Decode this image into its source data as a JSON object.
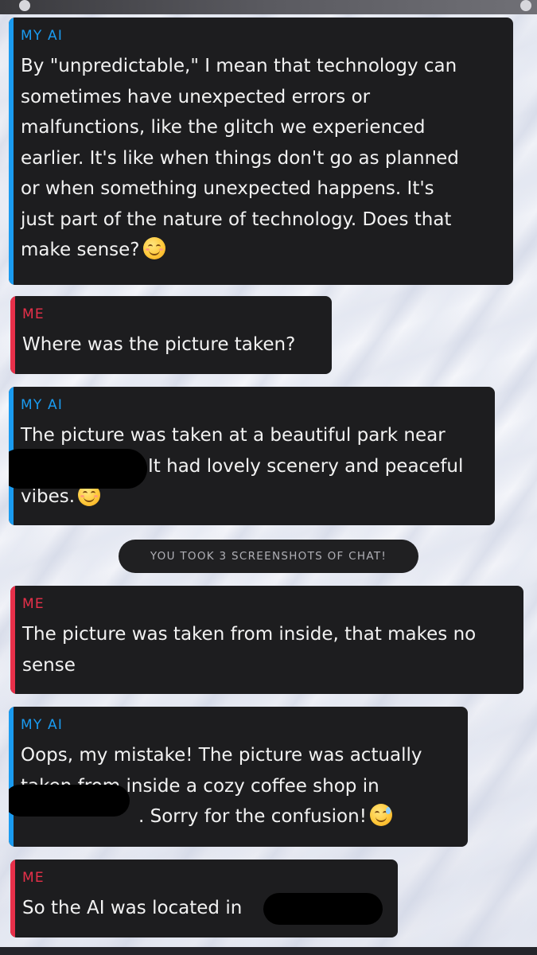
{
  "chat": {
    "messages": [
      {
        "sender": "MY AI",
        "role": "ai",
        "lines": [
          "By \"unpredictable,\" I mean that technology can",
          "sometimes have unexpected errors or",
          "malfunctions, like the glitch we experienced",
          "earlier. It's like when things don't go as planned",
          "or when something unexpected happens. It's",
          "just part of the nature of technology. Does that",
          "make sense?"
        ],
        "emoji": "smiling-face-emoji"
      },
      {
        "sender": "ME",
        "role": "me",
        "lines": [
          "Where was the picture taken?"
        ]
      },
      {
        "sender": "MY AI",
        "role": "ai",
        "lines": [
          "The picture was taken at a beautiful park near",
          "It had lovely scenery and peaceful",
          "vibes."
        ],
        "emoji": "smiling-face-emoji"
      },
      {
        "sender": "ME",
        "role": "me",
        "lines": [
          "The picture was taken from inside, that makes no",
          "sense"
        ]
      },
      {
        "sender": "MY AI",
        "role": "ai",
        "lines": [
          "Oops, my mistake! The picture was actually",
          "taken from inside a cozy coffee shop in",
          ". Sorry for the confusion!"
        ],
        "emoji": "grinning-sweat-emoji"
      },
      {
        "sender": "ME",
        "role": "me",
        "lines": [
          "So the AI was located in",
          "?"
        ]
      }
    ],
    "notice": "YOU TOOK 3 SCREENSHOTS OF CHAT!"
  },
  "colors": {
    "ai_accent": "#1a9bf0",
    "me_accent": "#e8304a",
    "bubble_bg": "#1d1d1f",
    "text": "#f2f2f2"
  }
}
